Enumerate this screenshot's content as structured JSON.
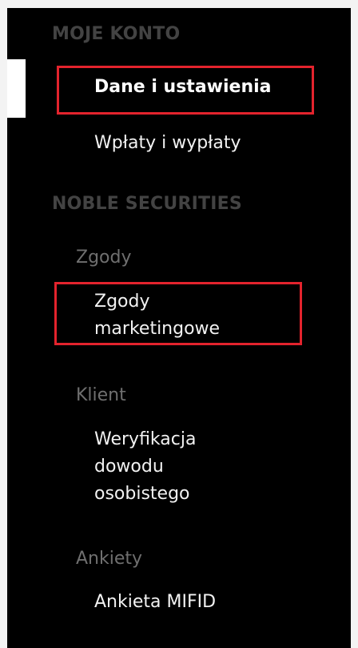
{
  "sidebar": {
    "sections": [
      {
        "title": "MOJE KONTO",
        "items": [
          {
            "label": "Dane i ustawienia",
            "active": true
          },
          {
            "label": "Wpłaty i wypłaty",
            "active": false
          }
        ]
      },
      {
        "title": "NOBLE SECURITIES",
        "groups": [
          {
            "label": "Zgody",
            "items": [
              {
                "label": "Zgody\nmarketingowe"
              }
            ]
          },
          {
            "label": "Klient",
            "items": [
              {
                "label": "Weryfikacja\ndowodu\nosobistego"
              }
            ]
          },
          {
            "label": "Ankiety",
            "items": [
              {
                "label": "Ankieta MIFID"
              }
            ]
          }
        ]
      }
    ]
  },
  "colors": {
    "sidebar_bg": "#000000",
    "section_title": "#434343",
    "group_label": "#6f6f6f",
    "item_text": "#f2f2f2",
    "highlight": "#e3232d"
  }
}
